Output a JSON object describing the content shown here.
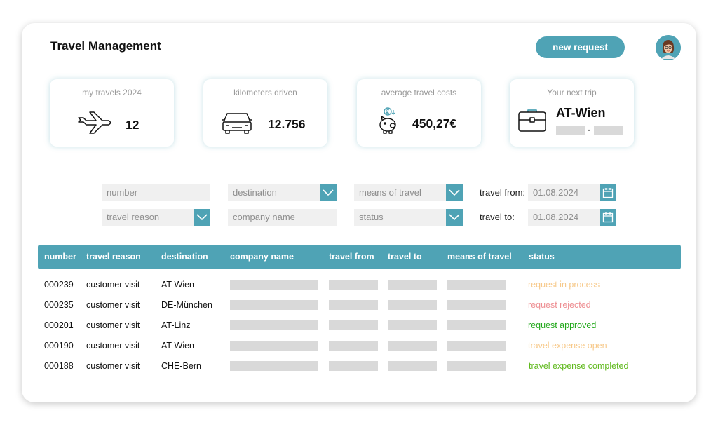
{
  "app": {
    "title": "Travel Management",
    "new_request_label": "new request"
  },
  "kpis": {
    "travels": {
      "label": "my travels 2024",
      "value": "12",
      "icon": "airplane-icon"
    },
    "kilometers": {
      "label": "kilometers driven",
      "value": "12.756",
      "icon": "car-icon"
    },
    "costs": {
      "label": "average travel costs",
      "value": "450,27€",
      "icon": "piggy-bank-icon"
    },
    "next_trip": {
      "label": "Your next trip",
      "destination": "AT-Wien",
      "separator": "-",
      "icon": "briefcase-icon"
    }
  },
  "filters": {
    "number_placeholder": "number",
    "destination_placeholder": "destination",
    "means_placeholder": "means of travel",
    "travel_from_label": "travel from:",
    "travel_from_value": "01.08.2024",
    "travel_reason_placeholder": "travel reason",
    "company_placeholder": "company name",
    "status_placeholder": "status",
    "travel_to_label": "travel to:",
    "travel_to_value": "01.08.2024"
  },
  "table": {
    "headers": [
      "number",
      "travel reason",
      "destination",
      "company name",
      "travel from",
      "travel to",
      "means of travel",
      "status"
    ],
    "rows": [
      {
        "number": "000239",
        "reason": "customer visit",
        "destination": "AT-Wien",
        "status": "request in process"
      },
      {
        "number": "000235",
        "reason": "customer visit",
        "destination": "DE-München",
        "status": "request rejected"
      },
      {
        "number": "000201",
        "reason": "customer visit",
        "destination": "AT-Linz",
        "status": "request approved"
      },
      {
        "number": "000190",
        "reason": "customer visit",
        "destination": "AT-Wien",
        "status": "travel expense open"
      },
      {
        "number": "000188",
        "reason": "customer visit",
        "destination": "CHE-Bern",
        "status": "travel expense completed"
      }
    ]
  },
  "colors": {
    "accent": "#4fa3b5",
    "status_in_process": "#f7c98a",
    "status_rejected": "#ee8e92",
    "status_approved": "#22a81b",
    "status_expense_open": "#f7c98a",
    "status_expense_completed": "#5fb91c"
  }
}
